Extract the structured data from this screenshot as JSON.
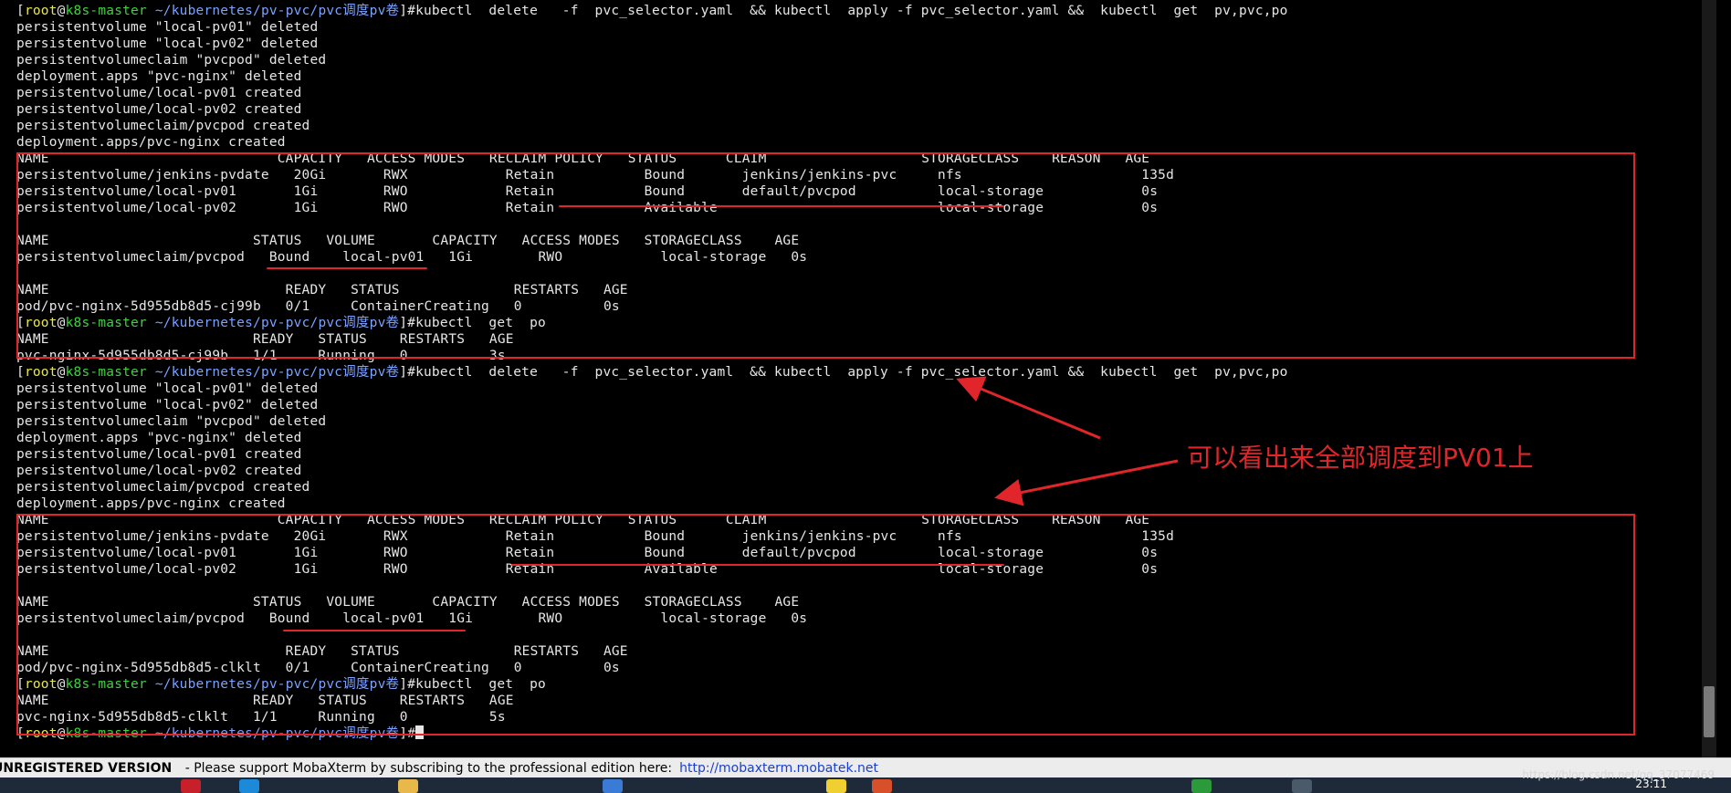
{
  "prompt": {
    "user": "root",
    "at": "@",
    "host": "k8s-master",
    "path": " ~/kubernetes/pv-pvc/pvc调度pv卷"
  },
  "terminal": {
    "lines": [
      {
        "type": "prompt",
        "cmd": "]#kubectl  delete   -f  pvc_selector.yaml  && kubectl  apply -f pvc_selector.yaml &&  kubectl  get  pv,pvc,po"
      },
      {
        "type": "out",
        "text": "persistentvolume \"local-pv01\" deleted"
      },
      {
        "type": "out",
        "text": "persistentvolume \"local-pv02\" deleted"
      },
      {
        "type": "out",
        "text": "persistentvolumeclaim \"pvcpod\" deleted"
      },
      {
        "type": "out",
        "text": "deployment.apps \"pvc-nginx\" deleted"
      },
      {
        "type": "out",
        "text": "persistentvolume/local-pv01 created"
      },
      {
        "type": "out",
        "text": "persistentvolume/local-pv02 created"
      },
      {
        "type": "out",
        "text": "persistentvolumeclaim/pvcpod created"
      },
      {
        "type": "out",
        "text": "deployment.apps/pvc-nginx created"
      },
      {
        "type": "out",
        "text": "NAME                            CAPACITY   ACCESS MODES   RECLAIM POLICY   STATUS      CLAIM                   STORAGECLASS    REASON   AGE"
      },
      {
        "type": "out",
        "text": "persistentvolume/jenkins-pvdate   20Gi       RWX            Retain           Bound       jenkins/jenkins-pvc     nfs                      135d"
      },
      {
        "type": "out",
        "text": "persistentvolume/local-pv01       1Gi        RWO            Retain           Bound       default/pvcpod          local-storage            0s"
      },
      {
        "type": "out",
        "text": "persistentvolume/local-pv02       1Gi        RWO            Retain           Available                           local-storage            0s"
      },
      {
        "type": "out",
        "text": ""
      },
      {
        "type": "out",
        "text": "NAME                         STATUS   VOLUME       CAPACITY   ACCESS MODES   STORAGECLASS    AGE"
      },
      {
        "type": "out",
        "text": "persistentvolumeclaim/pvcpod   Bound    local-pv01   1Gi        RWO            local-storage   0s"
      },
      {
        "type": "out",
        "text": ""
      },
      {
        "type": "out",
        "text": "NAME                             READY   STATUS              RESTARTS   AGE"
      },
      {
        "type": "out",
        "text": "pod/pvc-nginx-5d955db8d5-cj99b   0/1     ContainerCreating   0          0s"
      },
      {
        "type": "prompt",
        "cmd": "]#kubectl  get  po"
      },
      {
        "type": "out",
        "text": "NAME                         READY   STATUS    RESTARTS   AGE"
      },
      {
        "type": "out",
        "text": "pvc-nginx-5d955db8d5-cj99b   1/1     Running   0          3s"
      },
      {
        "type": "prompt",
        "cmd": "]#kubectl  delete   -f  pvc_selector.yaml  && kubectl  apply -f pvc_selector.yaml &&  kubectl  get  pv,pvc,po"
      },
      {
        "type": "out",
        "text": "persistentvolume \"local-pv01\" deleted"
      },
      {
        "type": "out",
        "text": "persistentvolume \"local-pv02\" deleted"
      },
      {
        "type": "out",
        "text": "persistentvolumeclaim \"pvcpod\" deleted"
      },
      {
        "type": "out",
        "text": "deployment.apps \"pvc-nginx\" deleted"
      },
      {
        "type": "out",
        "text": "persistentvolume/local-pv01 created"
      },
      {
        "type": "out",
        "text": "persistentvolume/local-pv02 created"
      },
      {
        "type": "out",
        "text": "persistentvolumeclaim/pvcpod created"
      },
      {
        "type": "out",
        "text": "deployment.apps/pvc-nginx created"
      },
      {
        "type": "out",
        "text": "NAME                            CAPACITY   ACCESS MODES   RECLAIM POLICY   STATUS      CLAIM                   STORAGECLASS    REASON   AGE"
      },
      {
        "type": "out",
        "text": "persistentvolume/jenkins-pvdate   20Gi       RWX            Retain           Bound       jenkins/jenkins-pvc     nfs                      135d"
      },
      {
        "type": "out",
        "text": "persistentvolume/local-pv01       1Gi        RWO            Retain           Bound       default/pvcpod          local-storage            0s"
      },
      {
        "type": "out",
        "text": "persistentvolume/local-pv02       1Gi        RWO            Retain           Available                           local-storage            0s"
      },
      {
        "type": "out",
        "text": ""
      },
      {
        "type": "out",
        "text": "NAME                         STATUS   VOLUME       CAPACITY   ACCESS MODES   STORAGECLASS    AGE"
      },
      {
        "type": "out",
        "text": "persistentvolumeclaim/pvcpod   Bound    local-pv01   1Gi        RWO            local-storage   0s"
      },
      {
        "type": "out",
        "text": ""
      },
      {
        "type": "out",
        "text": "NAME                             READY   STATUS              RESTARTS   AGE"
      },
      {
        "type": "out",
        "text": "pod/pvc-nginx-5d955db8d5-clklt   0/1     ContainerCreating   0          0s"
      },
      {
        "type": "prompt",
        "cmd": "]#kubectl  get  po"
      },
      {
        "type": "out",
        "text": "NAME                         READY   STATUS    RESTARTS   AGE"
      },
      {
        "type": "out",
        "text": "pvc-nginx-5d955db8d5-clklt   1/1     Running   0          5s"
      },
      {
        "type": "prompt",
        "cmd": "]#",
        "cursor": true
      }
    ]
  },
  "annotation": {
    "text": "可以看出来全部调度到PV01上",
    "color": "#e0262a"
  },
  "status_bar": {
    "registered": "UNREGISTERED VERSION",
    "message": " -  Please support MobaXterm by subscribing to the professional edition here:",
    "link": "http://mobaxterm.mobatek.net"
  },
  "taskbar": {
    "clock": "23:11"
  },
  "watermark": "https://blog.csdn.net/qq_37077469",
  "colors": {
    "background": "#000000",
    "text": "#e6e6e6",
    "user": "#e8e84a",
    "host": "#3bd43b",
    "path": "#7aa2ff",
    "annotation_red": "#e0262a"
  }
}
